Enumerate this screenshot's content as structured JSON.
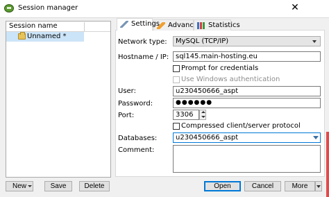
{
  "window": {
    "title": "Session manager",
    "close_glyph": "✕"
  },
  "sessions": {
    "header": "Session name",
    "items": [
      {
        "label": "Unnamed *",
        "icon": "folder-icon",
        "selected": true
      }
    ]
  },
  "buttons": {
    "new": "New",
    "save": "Save",
    "delete": "Delete",
    "open": "Open",
    "cancel": "Cancel",
    "more": "More"
  },
  "tabs": [
    {
      "label": "Settings",
      "active": true,
      "icon": "wrench-icon"
    },
    {
      "label": "Advanced",
      "active": false,
      "icon": "pencil-icon"
    },
    {
      "label": "Statistics",
      "active": false,
      "icon": "chart-icon"
    }
  ],
  "form": {
    "network_type": {
      "label": "Network type:",
      "value": "MySQL (TCP/IP)"
    },
    "hostname": {
      "label": "Hostname / IP:",
      "value": "sql145.main-hosting.eu"
    },
    "prompt_credentials": {
      "label": "Prompt for credentials",
      "checked": false
    },
    "windows_auth": {
      "label": "Use Windows authentication",
      "checked": false,
      "disabled": true
    },
    "user": {
      "label": "User:",
      "value": "u230450666_aspt"
    },
    "password": {
      "label": "Password:",
      "value": "●●●●●●"
    },
    "port": {
      "label": "Port:",
      "value": "3306"
    },
    "compressed": {
      "label": "Compressed client/server protocol",
      "checked": false
    },
    "databases": {
      "label": "Databases:",
      "value": "u230450666_aspt"
    },
    "comment": {
      "label": "Comment:",
      "value": ""
    }
  },
  "colors": {
    "accent": "#0078d7",
    "selection": "#cce4f7"
  }
}
